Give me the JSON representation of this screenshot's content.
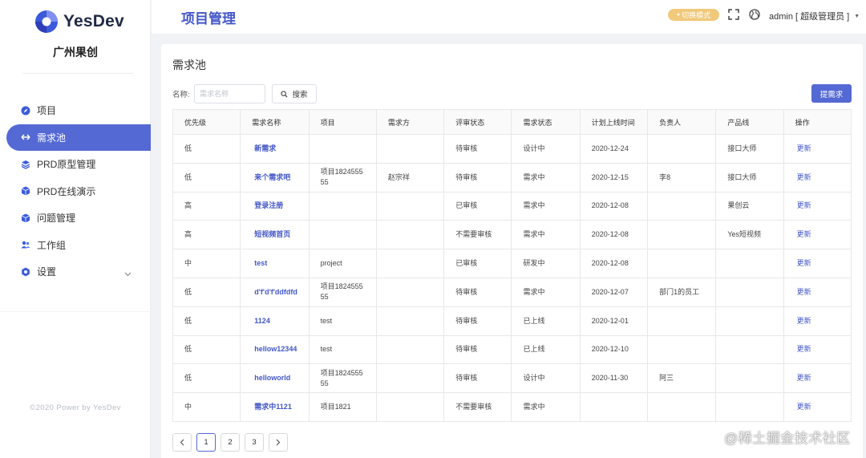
{
  "app": {
    "brand_name": "YesDev",
    "org_name": "广州果创",
    "copyright": "©2020 Power by YesDev"
  },
  "colors": {
    "accent": "#5469d4",
    "link": "#4457c8",
    "switch_pill": "#f0c97a"
  },
  "sidebar": {
    "items": [
      {
        "label": "项目",
        "icon": "compass-icon"
      },
      {
        "label": "需求池",
        "icon": "double-arrow-icon"
      },
      {
        "label": "PRD原型管理",
        "icon": "layers-icon"
      },
      {
        "label": "PRD在线演示",
        "icon": "cube-icon"
      },
      {
        "label": "问题管理",
        "icon": "cube-icon"
      },
      {
        "label": "工作组",
        "icon": "users-icon"
      },
      {
        "label": "设置",
        "icon": "gear-icon"
      }
    ]
  },
  "header": {
    "title": "项目管理",
    "switch_mode": "切换模式",
    "user": "admin [ 超级管理员 ]"
  },
  "main": {
    "title": "需求池",
    "search_label": "名称:",
    "search_placeholder": "需求名称",
    "search_button": "搜索",
    "submit_button": "提需求",
    "columns": [
      "优先级",
      "需求名称",
      "项目",
      "需求方",
      "评审状态",
      "需求状态",
      "计划上线时间",
      "负责人",
      "产品线",
      "操作"
    ],
    "rows": [
      {
        "priority": "低",
        "name": "新需求",
        "project": "",
        "requester": "",
        "review": "待审核",
        "status": "设计中",
        "date": "2020-12-24",
        "owner": "",
        "line": "接口大师",
        "op": "更新"
      },
      {
        "priority": "低",
        "name": "来个需求吧",
        "project": "项目182455555",
        "requester": "赵宗祥",
        "review": "待审核",
        "status": "需求中",
        "date": "2020-12-15",
        "owner": "李8",
        "line": "接口大师",
        "op": "更新"
      },
      {
        "priority": "高",
        "name": "登录注册",
        "project": "",
        "requester": "",
        "review": "已审核",
        "status": "需求中",
        "date": "2020-12-08",
        "owner": "",
        "line": "果创云",
        "op": "更新"
      },
      {
        "priority": "高",
        "name": "短视频首页",
        "project": "",
        "requester": "",
        "review": "不需要审核",
        "status": "需求中",
        "date": "2020-12-08",
        "owner": "",
        "line": "Yes短视频",
        "op": "更新"
      },
      {
        "priority": "中",
        "name": "test",
        "project": "project",
        "requester": "",
        "review": "已审核",
        "status": "研发中",
        "date": "2020-12-08",
        "owner": "",
        "line": "",
        "op": "更新"
      },
      {
        "priority": "低",
        "name": "d'f'd'f'ddfdfd",
        "project": "项目182455555",
        "requester": "",
        "review": "待审核",
        "status": "需求中",
        "date": "2020-12-07",
        "owner": "部门1的员工",
        "line": "",
        "op": "更新"
      },
      {
        "priority": "低",
        "name": "1124",
        "project": "test",
        "requester": "",
        "review": "待审核",
        "status": "已上线",
        "date": "2020-12-01",
        "owner": "",
        "line": "",
        "op": "更新"
      },
      {
        "priority": "低",
        "name": "hellow12344",
        "project": "test",
        "requester": "",
        "review": "待审核",
        "status": "已上线",
        "date": "2020-12-10",
        "owner": "",
        "line": "",
        "op": "更新"
      },
      {
        "priority": "低",
        "name": "helloworld",
        "project": "项目182455555",
        "requester": "",
        "review": "待审核",
        "status": "设计中",
        "date": "2020-11-30",
        "owner": "阿三",
        "line": "",
        "op": "更新"
      },
      {
        "priority": "中",
        "name": "需求中1121",
        "project": "项目1821",
        "requester": "",
        "review": "不需要审核",
        "status": "需求中",
        "date": "",
        "owner": "",
        "line": "",
        "op": "更新"
      }
    ]
  },
  "pagination": {
    "pages": [
      "1",
      "2",
      "3"
    ],
    "current": "1"
  },
  "watermark": "@稀土掘金技术社区"
}
